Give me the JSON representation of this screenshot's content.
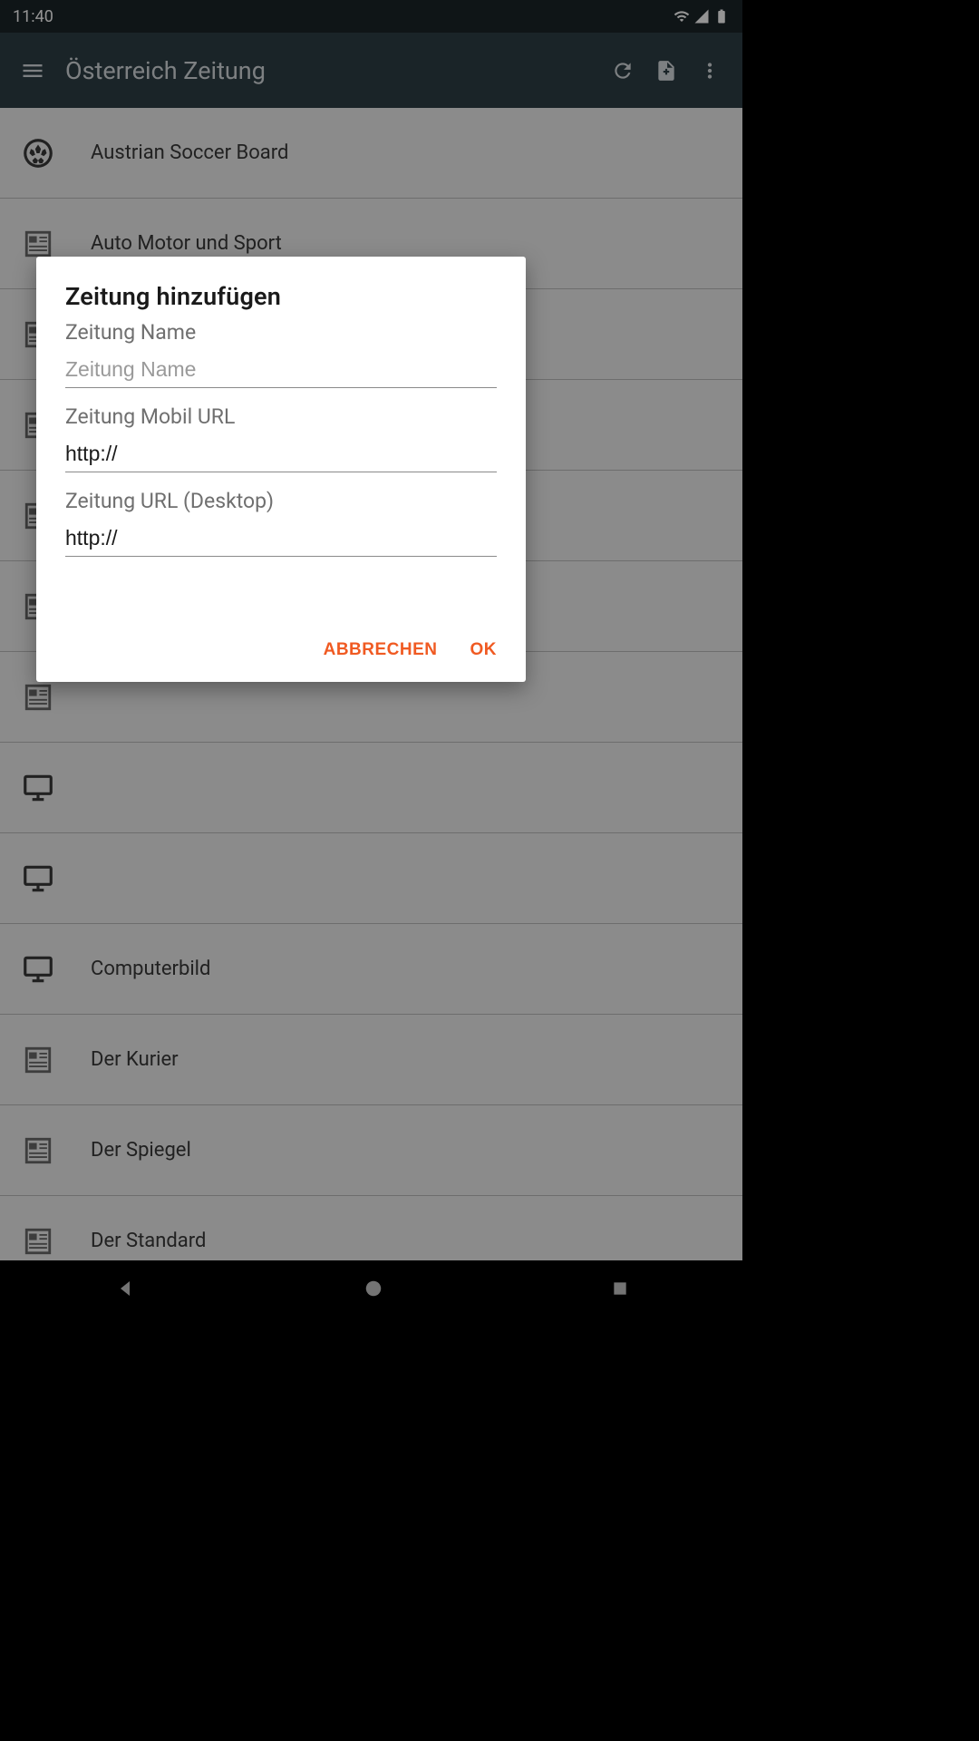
{
  "statusbar": {
    "time": "11:40"
  },
  "appbar": {
    "title": "Österreich Zeitung"
  },
  "list": {
    "items": [
      {
        "icon": "soccer",
        "label": "Austrian Soccer Board"
      },
      {
        "icon": "news",
        "label": "Auto Motor und Sport"
      },
      {
        "icon": "news",
        "label": ""
      },
      {
        "icon": "news",
        "label": ""
      },
      {
        "icon": "news",
        "label": ""
      },
      {
        "icon": "news",
        "label": ""
      },
      {
        "icon": "news",
        "label": ""
      },
      {
        "icon": "monitor",
        "label": ""
      },
      {
        "icon": "monitor",
        "label": ""
      },
      {
        "icon": "monitor",
        "label": "Computerbild"
      },
      {
        "icon": "news",
        "label": "Der Kurier"
      },
      {
        "icon": "news",
        "label": "Der Spiegel"
      },
      {
        "icon": "news",
        "label": "Der Standard"
      }
    ]
  },
  "dialog": {
    "title": "Zeitung hinzufügen",
    "name_label": "Zeitung Name",
    "name_placeholder": "Zeitung Name",
    "name_value": "",
    "mobile_label": "Zeitung Mobil URL",
    "mobile_value": "http://",
    "desktop_label": "Zeitung URL (Desktop)",
    "desktop_value": "http://",
    "cancel": "ABBRECHEN",
    "ok": "OK"
  }
}
